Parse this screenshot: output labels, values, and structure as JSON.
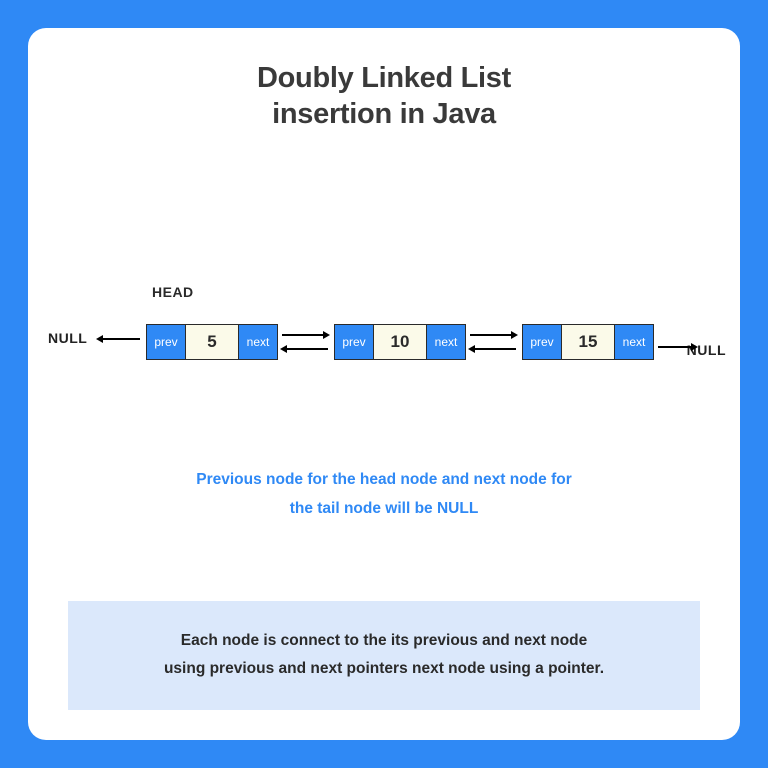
{
  "title_line1": "Doubly Linked List",
  "title_line2": "insertion in Java",
  "head_label": "HEAD",
  "null_left": "NULL",
  "null_right": "NULL",
  "ptr_prev": "prev",
  "ptr_next": "next",
  "nodes": [
    "5",
    "10",
    "15"
  ],
  "note_line1": "Previous node for the head node and next node for",
  "note_line2": "the tail node will be NULL",
  "footer_line1": "Each node is connect to the its previous and next node",
  "footer_line2": "using previous and next pointers next node using a pointer."
}
